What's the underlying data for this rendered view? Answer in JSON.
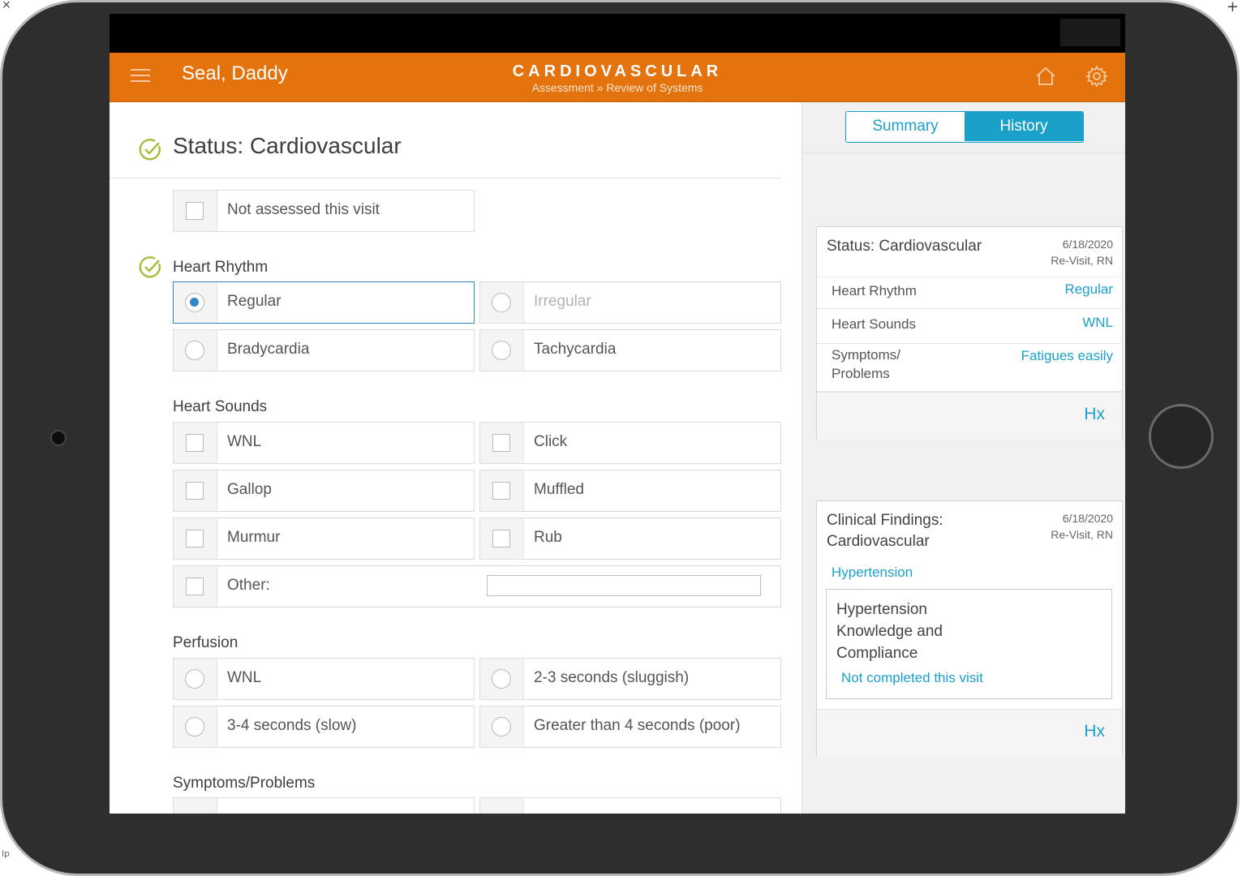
{
  "header": {
    "patient_name": "Seal, Daddy",
    "title": "CARDIOVASCULAR",
    "breadcrumb": "Assessment » Review of Systems",
    "accent_color": "#e4720d"
  },
  "form": {
    "section_title": "Status: Cardiovascular",
    "not_assessed_label": "Not assessed this visit",
    "heart_rhythm": {
      "label": "Heart Rhythm",
      "options": [
        "Regular",
        "Irregular",
        "Bradycardia",
        "Tachycardia"
      ],
      "selected": "Regular"
    },
    "heart_sounds": {
      "label": "Heart Sounds",
      "options": [
        "WNL",
        "Click",
        "Gallop",
        "Muffled",
        "Murmur",
        "Rub",
        "Other:"
      ],
      "other_value": ""
    },
    "perfusion": {
      "label": "Perfusion",
      "options": [
        "WNL",
        "2-3 seconds (sluggish)",
        "3-4 seconds (slow)",
        "Greater than 4 seconds (poor)"
      ]
    },
    "symptoms_label": "Symptoms/Problems"
  },
  "sidebar": {
    "tabs": [
      {
        "label": "Summary",
        "active": false
      },
      {
        "label": "History",
        "active": true
      }
    ],
    "status_card": {
      "title": "Status: Cardiovascular",
      "date": "6/18/2020",
      "visit": "Re-Visit, RN",
      "rows": [
        {
          "key": "Heart Rhythm",
          "value": "Regular"
        },
        {
          "key": "Heart Sounds",
          "value": "WNL"
        },
        {
          "key": "Symptoms/\nProblems",
          "value": "Fatigues easily"
        }
      ],
      "hx_label": "Hx"
    },
    "findings_card": {
      "title": "Clinical Findings:\nCardiovascular",
      "date": "6/18/2020",
      "visit": "Re-Visit, RN",
      "finding": "Hypertension",
      "goal_title": "Hypertension\nKnowledge and\nCompliance",
      "goal_status": "Not completed this visit",
      "hx_label": "Hx"
    }
  },
  "icons": {
    "menu": "hamburger-icon",
    "home": "home-icon",
    "settings": "gear-icon",
    "complete": "check-circle-icon"
  }
}
